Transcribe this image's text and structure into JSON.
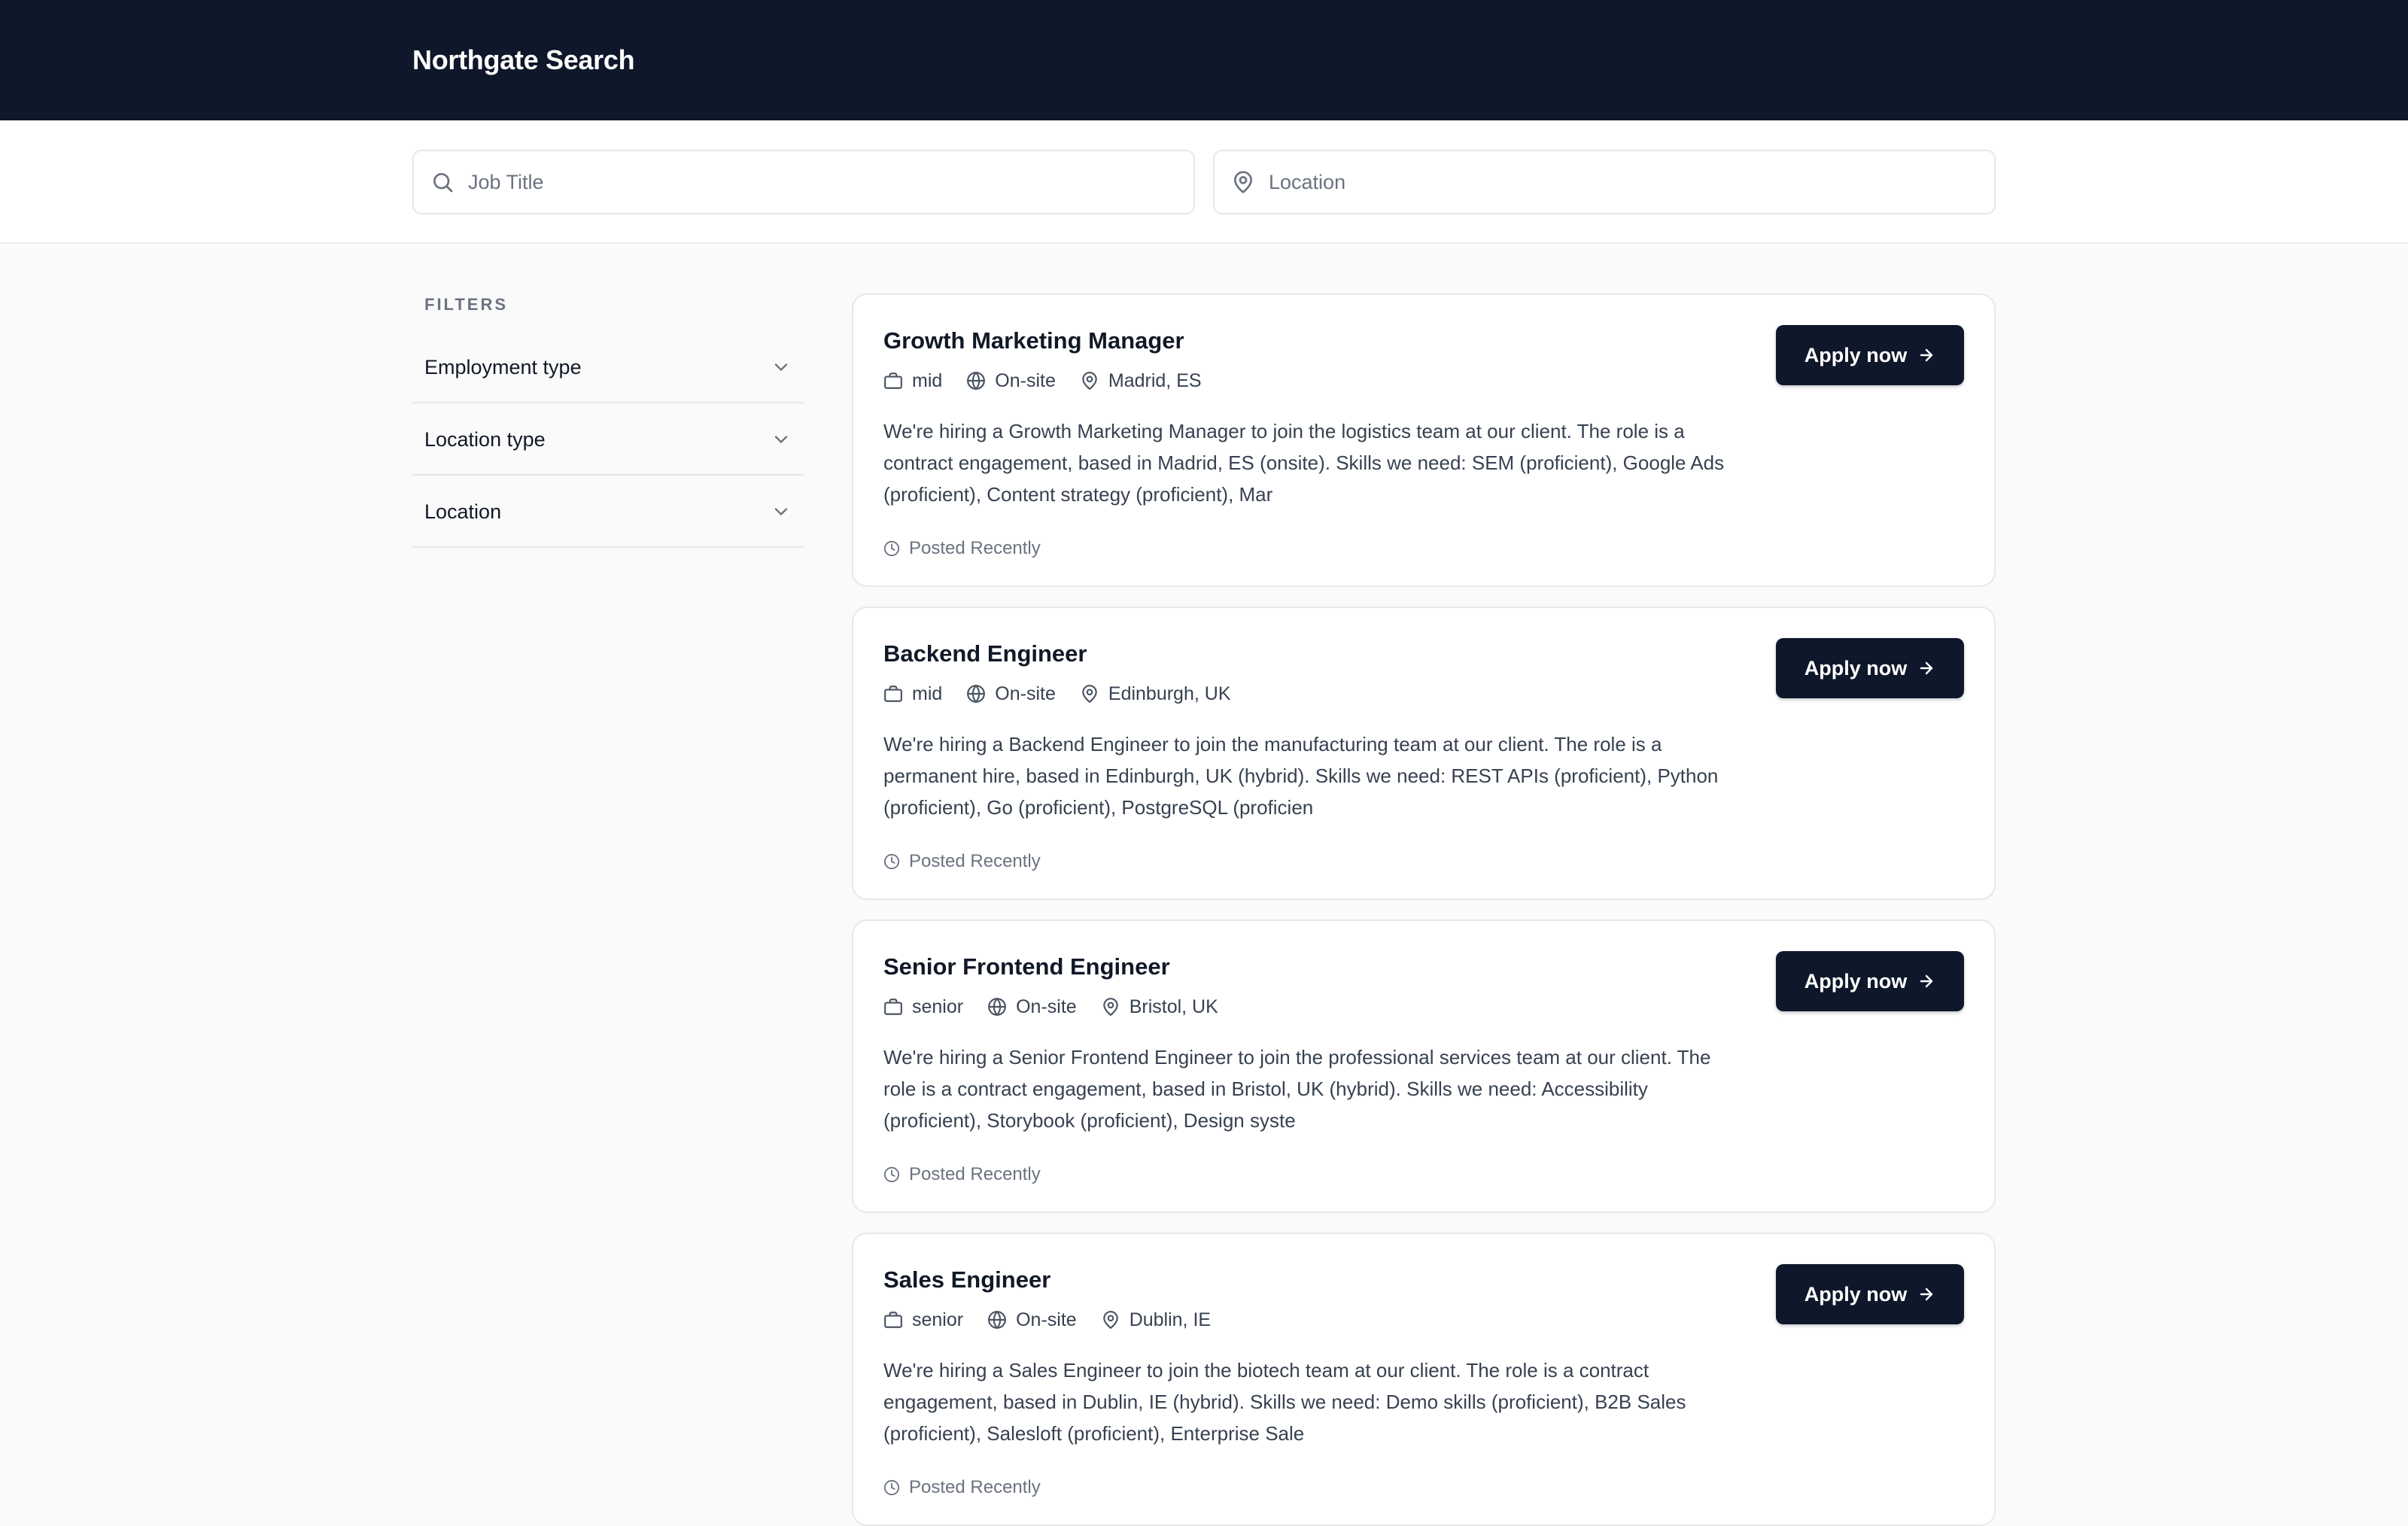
{
  "header": {
    "brand": "Northgate Search"
  },
  "search": {
    "title_placeholder": "Job Title",
    "title_value": "",
    "location_placeholder": "Location",
    "location_value": ""
  },
  "filters": {
    "heading": "FILTERS",
    "items": [
      {
        "label": "Employment type"
      },
      {
        "label": "Location type"
      },
      {
        "label": "Location"
      }
    ]
  },
  "jobs": [
    {
      "title": "Growth Marketing Manager",
      "level": "mid",
      "workplace": "On-site",
      "location": "Madrid, ES",
      "description": "We're hiring a Growth Marketing Manager to join the logistics team at our client. The role is a contract engagement, based in Madrid, ES (onsite). Skills we need: SEM (proficient), Google Ads (proficient), Content strategy (proficient), Mar",
      "posted": "Posted Recently",
      "apply_label": "Apply now"
    },
    {
      "title": "Backend Engineer",
      "level": "mid",
      "workplace": "On-site",
      "location": "Edinburgh, UK",
      "description": "We're hiring a Backend Engineer to join the manufacturing team at our client. The role is a permanent hire, based in Edinburgh, UK (hybrid). Skills we need: REST APIs (proficient), Python (proficient), Go (proficient), PostgreSQL (proficien",
      "posted": "Posted Recently",
      "apply_label": "Apply now"
    },
    {
      "title": "Senior Frontend Engineer",
      "level": "senior",
      "workplace": "On-site",
      "location": "Bristol, UK",
      "description": "We're hiring a Senior Frontend Engineer to join the professional services team at our client. The role is a contract engagement, based in Bristol, UK (hybrid). Skills we need: Accessibility (proficient), Storybook (proficient), Design syste",
      "posted": "Posted Recently",
      "apply_label": "Apply now"
    },
    {
      "title": "Sales Engineer",
      "level": "senior",
      "workplace": "On-site",
      "location": "Dublin, IE",
      "description": "We're hiring a Sales Engineer to join the biotech team at our client. The role is a contract engagement, based in Dublin, IE (hybrid). Skills we need: Demo skills (proficient), B2B Sales (proficient), Salesloft (proficient), Enterprise Sale",
      "posted": "Posted Recently",
      "apply_label": "Apply now"
    }
  ],
  "icons": {
    "search": "search-icon",
    "location_pin": "map-pin-icon",
    "level": "briefcase-icon",
    "workplace": "globe-icon",
    "job_location": "map-pin-icon",
    "posted": "clock-icon",
    "apply": "arrow-right-icon",
    "filter_toggle": "chevron-down-icon"
  },
  "colors": {
    "header_bg": "#0f172a",
    "primary_button": "#0f172a",
    "page_bg": "#fafafa"
  }
}
